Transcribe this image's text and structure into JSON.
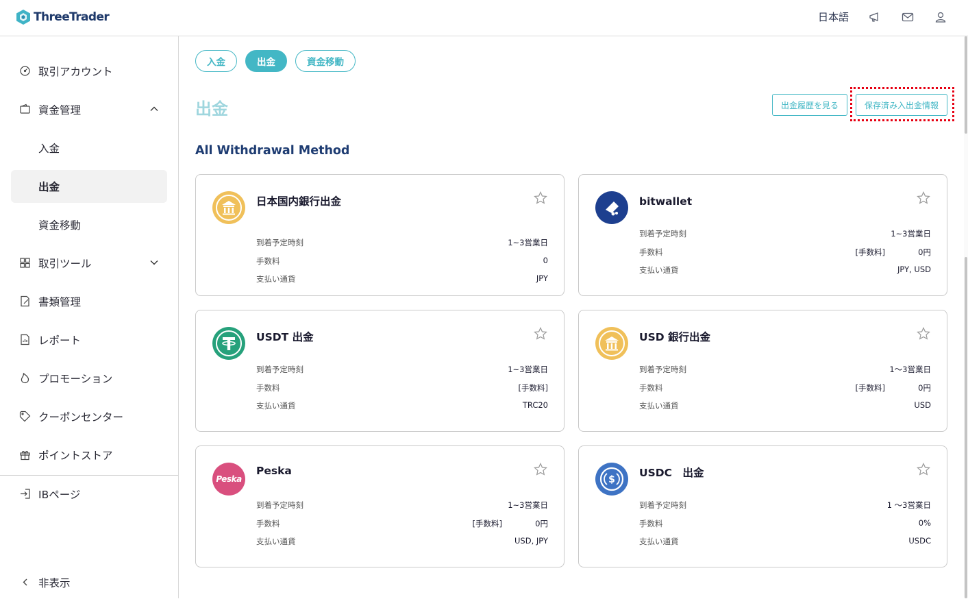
{
  "header": {
    "logo_text": "ThreeTrader",
    "language": "日本語",
    "icons": [
      "megaphone-icon",
      "mail-icon",
      "user-icon"
    ]
  },
  "sidebar": {
    "items": [
      {
        "label": "取引アカウント",
        "icon": "dashboard-icon"
      },
      {
        "label": "資金管理",
        "icon": "wallet-icon",
        "expanded": true
      },
      {
        "label": "入金"
      },
      {
        "label": "出金",
        "active": true
      },
      {
        "label": "資金移動"
      },
      {
        "label": "取引ツール",
        "icon": "tools-icon",
        "expanded": false
      },
      {
        "label": "書類管理",
        "icon": "document-icon"
      },
      {
        "label": "レポート",
        "icon": "report-icon"
      },
      {
        "label": "プロモーション",
        "icon": "flame-icon"
      },
      {
        "label": "クーポンセンター",
        "icon": "coupon-icon"
      },
      {
        "label": "ポイントストア",
        "icon": "gift-icon"
      },
      {
        "label": "IBページ",
        "icon": "login-icon"
      }
    ],
    "hide_label": "非表示"
  },
  "tabs": [
    {
      "label": "入金",
      "active": false
    },
    {
      "label": "出金",
      "active": true
    },
    {
      "label": "資金移動",
      "active": false
    }
  ],
  "page_title": "出金",
  "buttons": {
    "history": "出金履歴を見る",
    "saved_info": "保存済み入出金情報"
  },
  "section_title": "All Withdrawal Method",
  "labels": {
    "arrival": "到着予定時刻",
    "fee": "手数料",
    "currency": "支払い通貨"
  },
  "cards": [
    {
      "title": "日本国内銀行出金",
      "icon": "bank-icon",
      "arrival": "1~3営業日",
      "fee_tag": "",
      "fee": "0",
      "currency": "JPY"
    },
    {
      "title": "bitwallet",
      "icon": "bitwallet-icon",
      "arrival": "1~3営業日",
      "fee_tag": "[手数料]",
      "fee": "0円",
      "currency": "JPY, USD"
    },
    {
      "title": "USDT 出金",
      "icon": "tether-icon",
      "arrival": "1~3営業日",
      "fee_tag": "",
      "fee": "[手数料]",
      "currency": "TRC20"
    },
    {
      "title": "USD 銀行出金",
      "icon": "bank-icon",
      "arrival": "1〜3営業日",
      "fee_tag": "[手数料]",
      "fee": "0円",
      "currency": "USD"
    },
    {
      "title": "Peska",
      "icon": "peska-icon",
      "icon_text": "Peska",
      "arrival": "1~3営業日",
      "fee_tag": "[手数料]",
      "fee": "0円",
      "currency": "USD, JPY"
    },
    {
      "title": "USDC　出金",
      "icon": "usdc-icon",
      "arrival": "1 〜3営業日",
      "fee_tag": "",
      "fee": "0%",
      "currency": "USDC"
    }
  ],
  "colors": {
    "accent": "#43b7c5",
    "title_light": "#9fd6de",
    "section_title": "#1e3c72",
    "bank_icon_bg": "#f0c05a",
    "bitwallet_bg": "#1d3f8f",
    "tether_bg": "#26a17b",
    "peska_bg": "#d94f7e",
    "usdc_bg": "#3e73c4",
    "highlight": "#e60012"
  }
}
